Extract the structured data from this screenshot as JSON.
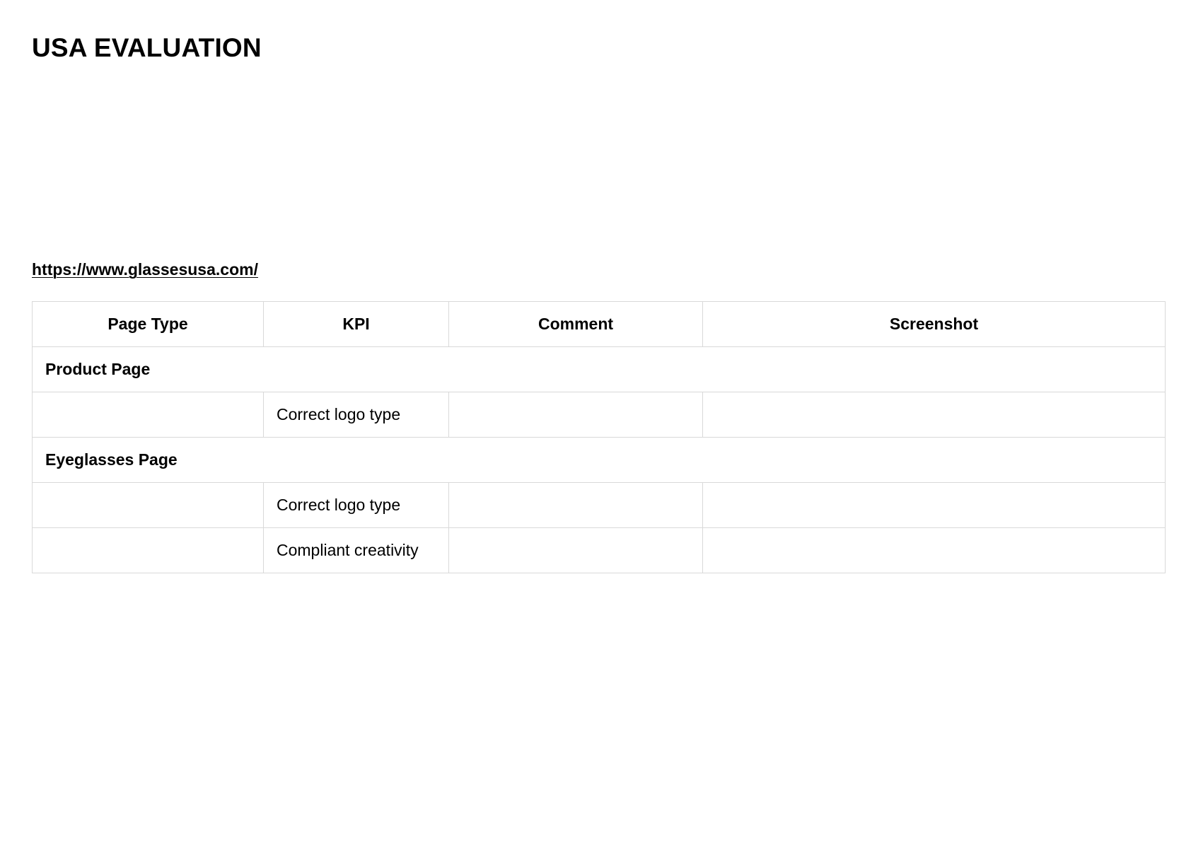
{
  "document": {
    "title": "USA EVALUATION",
    "url": "https://www.glassesusa.com/"
  },
  "table": {
    "headers": [
      "Page Type",
      "KPI",
      "Comment",
      "Screenshot"
    ],
    "sections": [
      {
        "name": "Product Page",
        "rows": [
          {
            "page_type": "",
            "kpi": "Correct logo type",
            "comment": "",
            "screenshot": ""
          }
        ]
      },
      {
        "name": "Eyeglasses Page",
        "rows": [
          {
            "page_type": "",
            "kpi": "Correct logo type",
            "comment": "",
            "screenshot": ""
          },
          {
            "page_type": "",
            "kpi": "Compliant creativity",
            "comment": "",
            "screenshot": ""
          }
        ]
      }
    ]
  }
}
